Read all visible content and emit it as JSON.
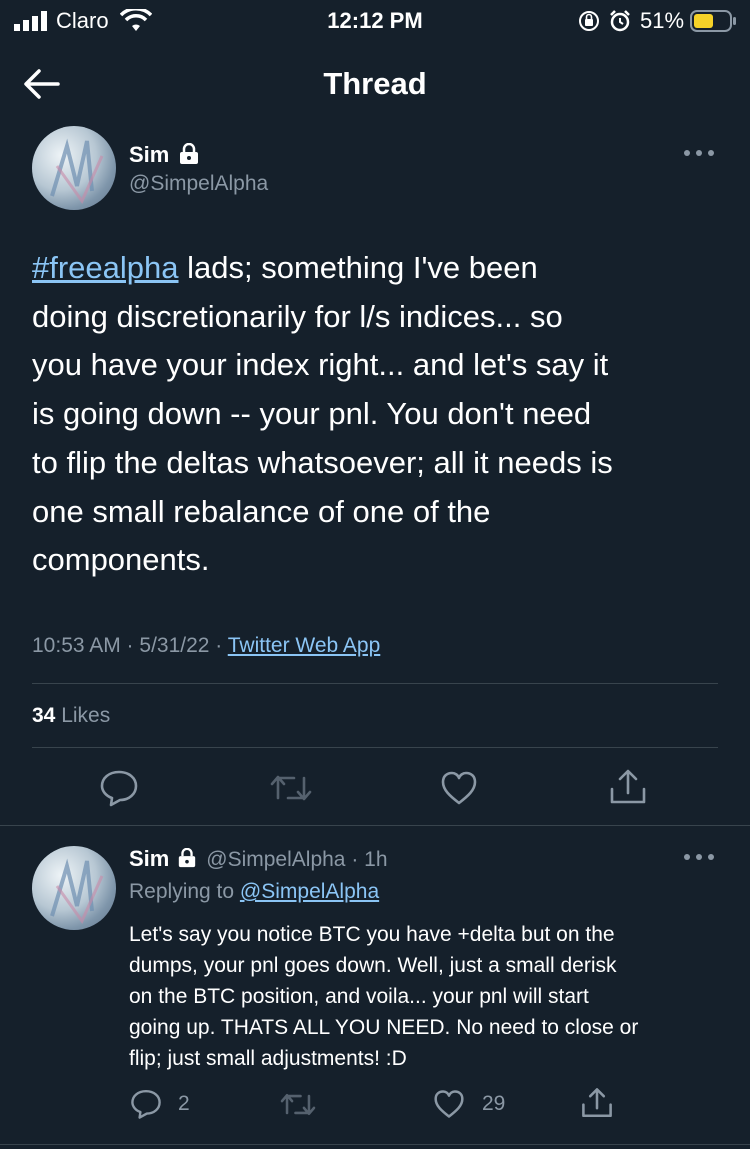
{
  "status_bar": {
    "carrier": "Claro",
    "time": "12:12 PM",
    "battery": "51%"
  },
  "header": {
    "title": "Thread"
  },
  "main_tweet": {
    "name": "Sim",
    "handle": "@SimpelAlpha",
    "hashtag": "#freealpha",
    "lines": [
      " lads; something I've been",
      "doing discretionarily for l/s indices... so",
      "you have your index right... and let's say it",
      "is going down -- your pnl. You don't need",
      "to flip the deltas whatsoever; all it needs is",
      "one small rebalance of one of the",
      "components."
    ],
    "timestamp": "10:53 AM · 5/31/22 · ",
    "source": "Twitter Web App",
    "likes_count": "34",
    "likes_label": " Likes"
  },
  "reply": {
    "name": "Sim",
    "handle_time": "@SimpelAlpha · 1h",
    "replying_prefix": "Replying to ",
    "replying_handle": "@SimpelAlpha",
    "lines": [
      "Let's say you notice BTC you have +delta but on the",
      "dumps, your pnl goes down. Well, just a small derisk",
      "on the BTC position, and voila... your pnl will start",
      "going up. THATS ALL YOU NEED. No need to close or",
      "flip; just small adjustments! :D"
    ],
    "reply_count": "2",
    "like_count": "29"
  }
}
